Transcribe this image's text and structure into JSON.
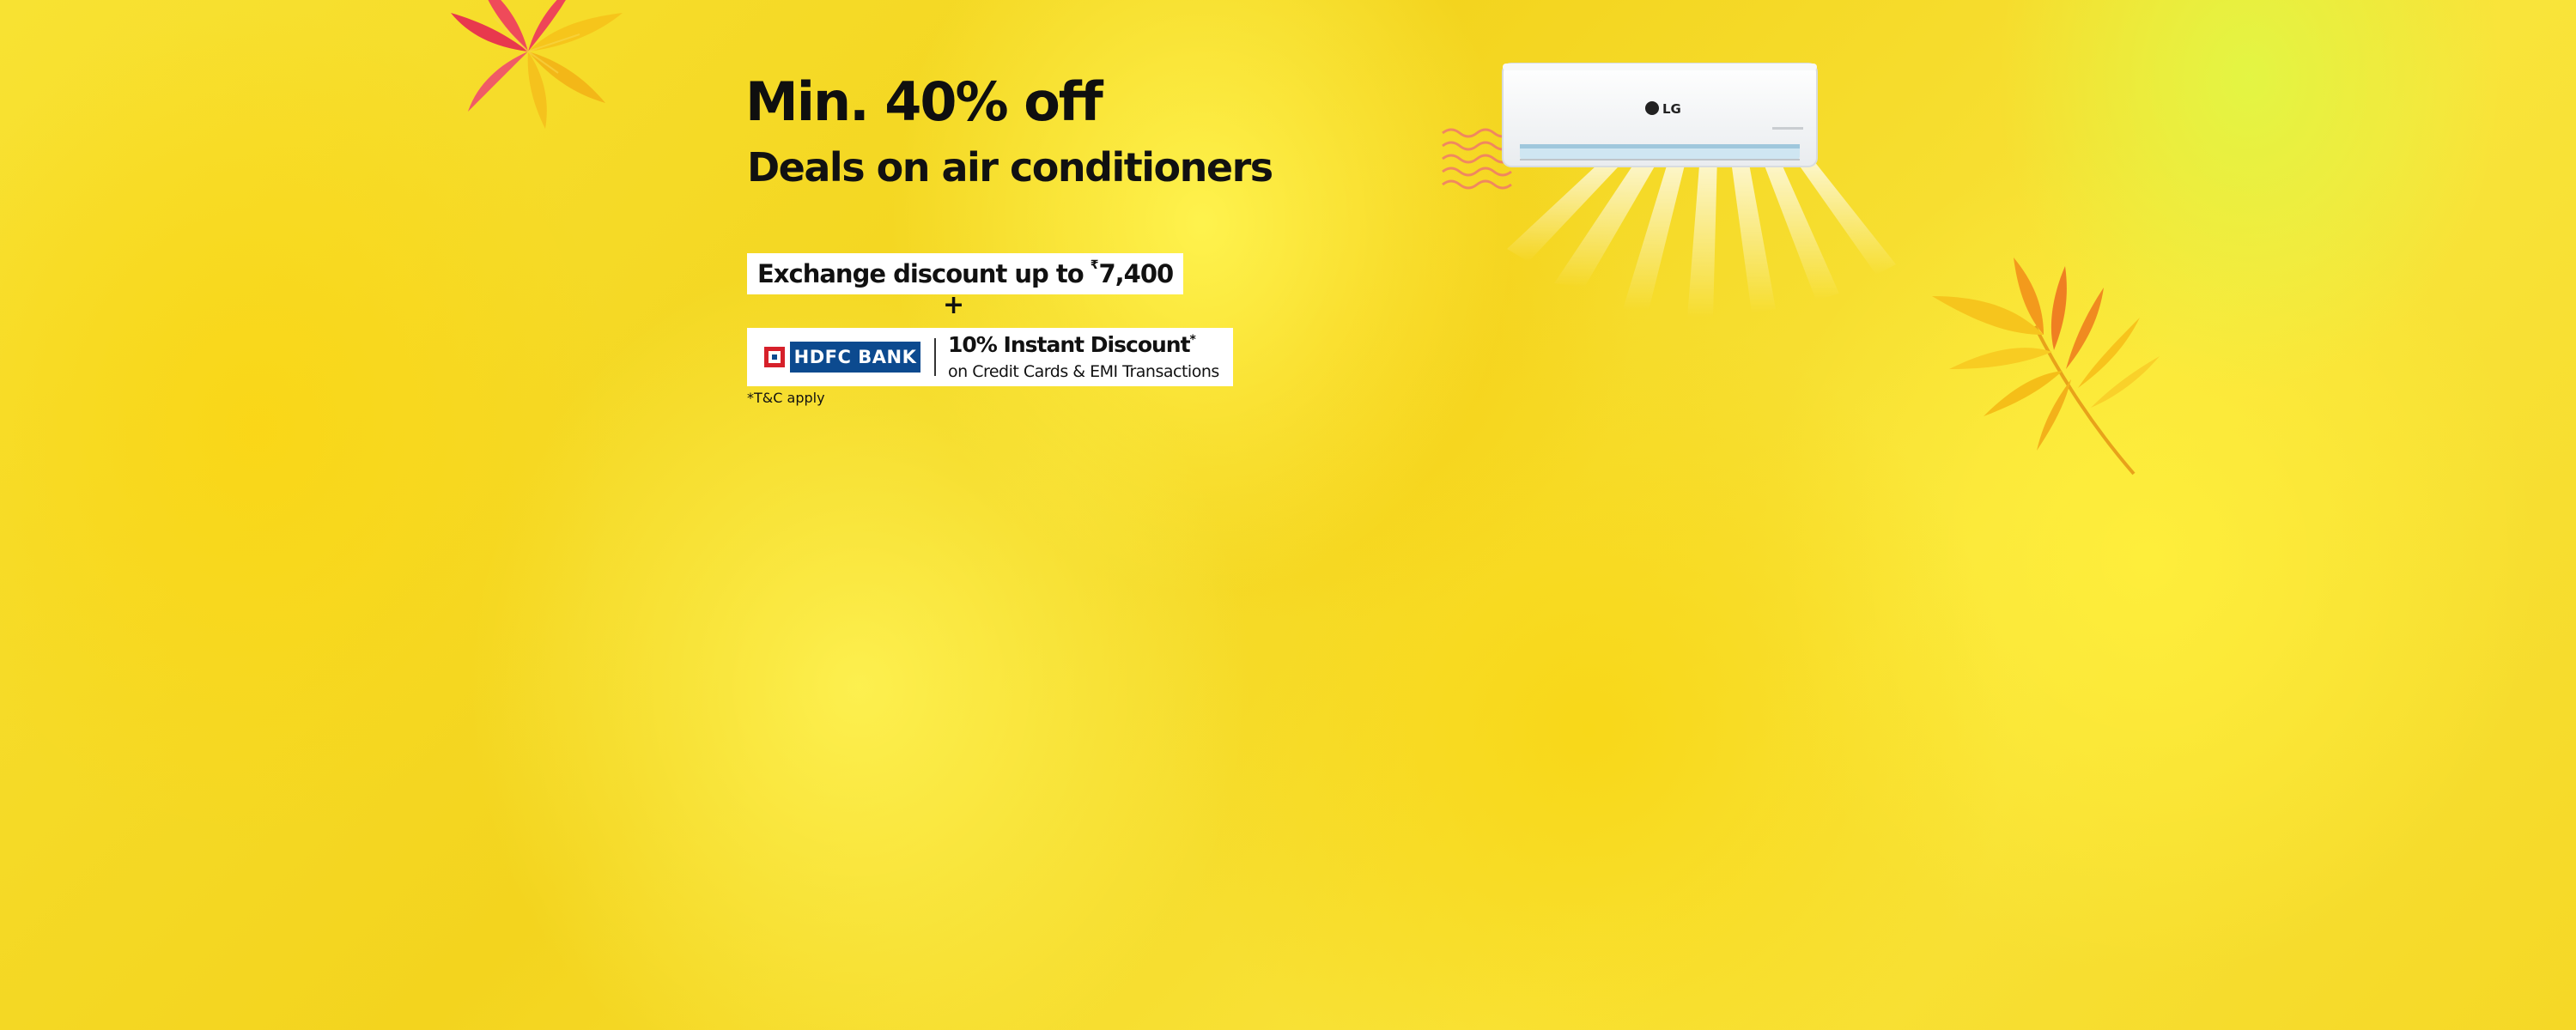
{
  "banner": {
    "headline": "Min. 40% off",
    "subhead": "Deals on air conditioners",
    "exchange": {
      "text": "Exchange discount up to",
      "currency_symbol": "₹",
      "amount": "7,400"
    },
    "plus": "+",
    "bank_offer": {
      "bank_name": "HDFC BANK",
      "title": "10% Instant Discount",
      "title_mark": "*",
      "subtitle": "on Credit Cards & EMI Transactions"
    },
    "tnc": "*T&C apply",
    "product": {
      "brand_logo": "LG"
    }
  },
  "colors": {
    "background": "#f7dd2a",
    "hdfc_blue": "#0c4a8f",
    "hdfc_red": "#d6202a"
  },
  "icons": {
    "top_leaf": "tropical-leaf-icon",
    "right_leaf": "palm-leaf-icon",
    "ac_unit": "air-conditioner-icon",
    "warm_waves": "heat-waves-icon"
  }
}
